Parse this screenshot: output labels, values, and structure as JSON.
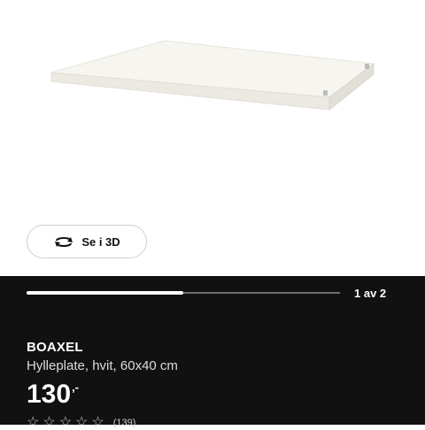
{
  "gallery": {
    "view3d_label": "Se i 3D",
    "pager_text": "1 av 2",
    "progress": 0.5
  },
  "product": {
    "name": "BOAXEL",
    "description": "Hylleplate, hvit, 60x40 cm",
    "price_amount": "130",
    "price_suffix": ",-",
    "rating_stars": 5,
    "review_count": "(139)"
  },
  "colors": {
    "panel_bg": "#111111",
    "accent_white": "#ffffff"
  },
  "icons": {
    "view3d": "rotate-3d-icon",
    "star": "star-icon"
  }
}
